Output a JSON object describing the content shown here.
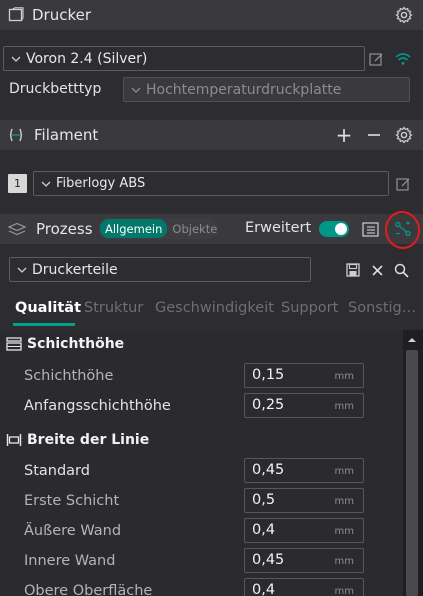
{
  "printer": {
    "section_title": "Drucker",
    "selected_printer": "Voron 2.4 (Silver)",
    "bed_type_label": "Druckbetttyp",
    "bed_type_value": "Hochtemperaturdruckplatte"
  },
  "filament": {
    "section_title": "Filament",
    "slot_number": "1",
    "selected_filament": "Fiberlogy ABS"
  },
  "process": {
    "section_title": "Prozess",
    "mode_tabs": [
      "Allgemein",
      "Objekte"
    ],
    "active_mode": "Allgemein",
    "advanced_label": "Erweitert",
    "advanced_enabled": true,
    "preset": "Druckerteile"
  },
  "tabs": [
    "Qualität",
    "Struktur",
    "Geschwindigkeit",
    "Support",
    "Sonstig…"
  ],
  "active_tab": "Qualität",
  "settings": {
    "groups": [
      {
        "title": "Schichthöhe",
        "rows": [
          {
            "label": "Schichthöhe",
            "value": "0,15",
            "unit": "mm"
          },
          {
            "label": "Anfangsschichthöhe",
            "value": "0,25",
            "unit": "mm"
          }
        ]
      },
      {
        "title": "Breite der Linie",
        "rows": [
          {
            "label": "Standard",
            "value": "0,45",
            "unit": "mm"
          },
          {
            "label": "Erste Schicht",
            "value": "0,5",
            "unit": "mm"
          },
          {
            "label": "Äußere Wand",
            "value": "0,4",
            "unit": "mm"
          },
          {
            "label": "Innere Wand",
            "value": "0,45",
            "unit": "mm"
          },
          {
            "label": "Obere Oberfläche",
            "value": "0,4",
            "unit": "mm"
          }
        ]
      }
    ]
  },
  "colors": {
    "accent": "#009688",
    "annotation": "#e21d1d"
  }
}
